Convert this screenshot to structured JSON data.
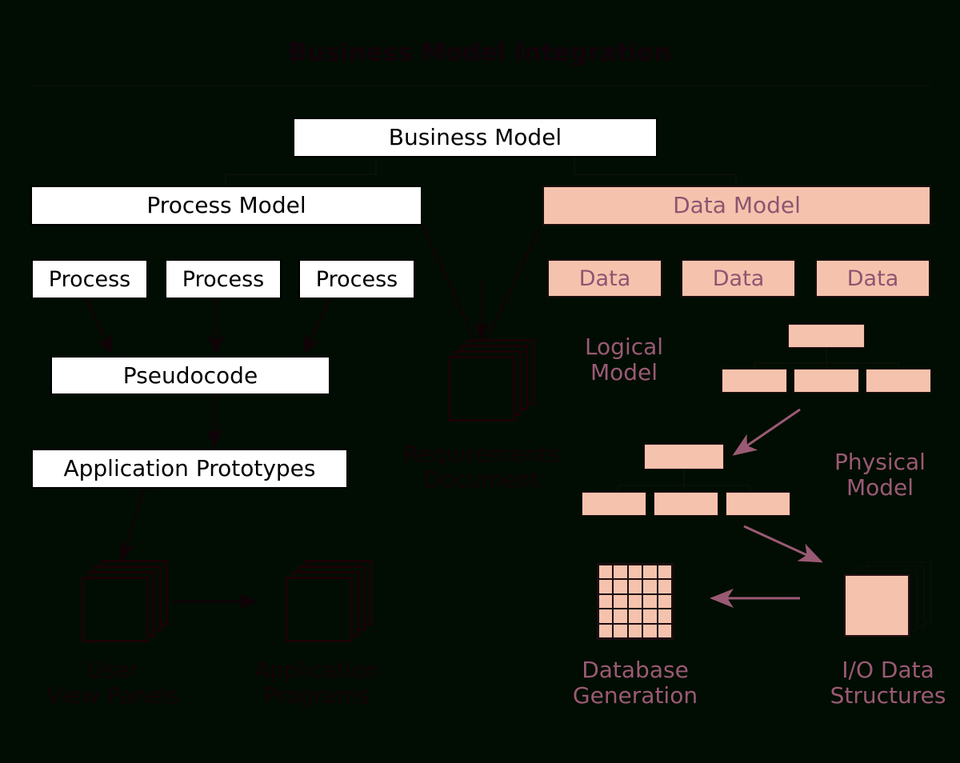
{
  "page": {
    "title": "Business Model Integration",
    "background_color": "#010d03",
    "white_box_fill": "#ffffff",
    "pink_box_fill": "#f5c3ad",
    "pink_text_color": "#8d5571",
    "dark_text_color": "#150208",
    "arrow_rose_color": "#9a5a74",
    "arrow_dark_color": "#100206"
  },
  "boxes": {
    "business_model": "Business Model",
    "process_model": "Process Model",
    "data_model": "Data Model",
    "process_1": "Process",
    "process_2": "Process",
    "process_3": "Process",
    "data_1": "Data",
    "data_2": "Data",
    "data_3": "Data",
    "pseudocode": "Pseudocode",
    "application_prototypes": "Application Prototypes"
  },
  "labels": {
    "requirements_document": "Requirements\nDocument",
    "user_view_panels": "User\nView Panels",
    "application_programs": "Application\nPrograms",
    "logical_model": "Logical\nModel",
    "physical_model": "Physical\nModel",
    "database_generation": "Database\nGeneration",
    "io_data_structures": "I/O Data\nStructures"
  },
  "diagram": {
    "logical_model_tree": {
      "parent_count": 1,
      "child_count": 3
    },
    "physical_model_tree": {
      "parent_count": 1,
      "child_count": 3
    },
    "database_grid": {
      "rows": 5,
      "columns": 5
    },
    "requirements_document_sheets": 4,
    "user_view_panels_sheets": 4,
    "application_programs_sheets": 4,
    "io_data_structures_sheets": 4
  }
}
